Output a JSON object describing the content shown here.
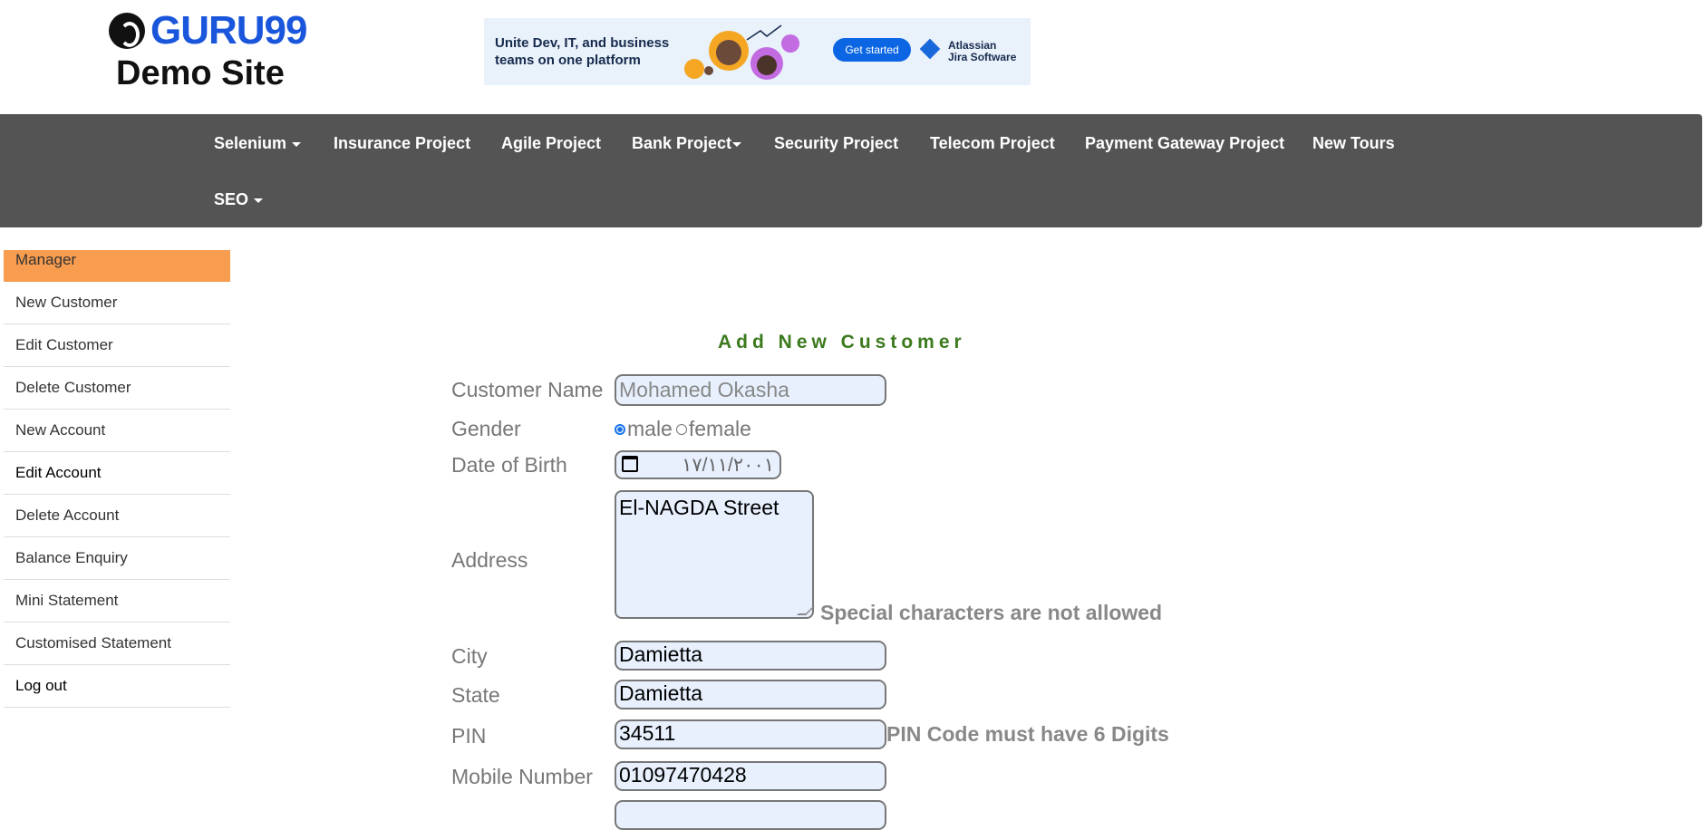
{
  "header": {
    "logo_text": "GURU99",
    "site_title": "Demo Site",
    "ad": {
      "headline": "Unite Dev, IT, and business teams on one platform",
      "button_label": "Get started",
      "brand_line1": "Atlassian",
      "brand_line2": "Jira Software"
    }
  },
  "nav": {
    "items": [
      {
        "label": "Selenium",
        "dropdown": true
      },
      {
        "label": "Insurance Project"
      },
      {
        "label": "Agile Project"
      },
      {
        "label": "Bank Project",
        "dropdown": true
      },
      {
        "label": "Security Project"
      },
      {
        "label": "Telecom Project"
      },
      {
        "label": "Payment Gateway Project"
      },
      {
        "label": "New Tours"
      },
      {
        "label": "SEO",
        "dropdown": true
      }
    ]
  },
  "sidebar": {
    "items": [
      {
        "label": "Manager",
        "active": true
      },
      {
        "label": "New Customer"
      },
      {
        "label": "Edit Customer"
      },
      {
        "label": "Delete Customer"
      },
      {
        "label": "New Account"
      },
      {
        "label": "Edit Account"
      },
      {
        "label": "Delete Account"
      },
      {
        "label": "Balance Enquiry"
      },
      {
        "label": "Mini Statement"
      },
      {
        "label": "Customised Statement"
      },
      {
        "label": "Log out"
      }
    ]
  },
  "form": {
    "title": "Add New Customer",
    "customer_name": {
      "label": "Customer Name",
      "placeholder": "Mohamed Okasha"
    },
    "gender": {
      "label": "Gender",
      "option_male": "male",
      "option_female": "female",
      "selected": "male"
    },
    "dob": {
      "label": "Date of Birth",
      "value": "١٧/١١/٢٠٠١"
    },
    "address": {
      "label": "Address",
      "value": "El-NAGDA Street",
      "error": "Special characters are not allowed"
    },
    "city": {
      "label": "City",
      "value": "Damietta"
    },
    "state": {
      "label": "State",
      "value": "Damietta"
    },
    "pin": {
      "label": "PIN",
      "value": "34511",
      "error": "PIN Code must have 6 Digits"
    },
    "mobile": {
      "label": "Mobile Number",
      "value": "01097470428"
    }
  },
  "colors": {
    "navbar_bg": "#545454",
    "sidebar_active": "#f89c4f",
    "form_title": "#3c7a1e",
    "input_bg": "#e8f0fe",
    "logo_blue": "#1a56db"
  }
}
